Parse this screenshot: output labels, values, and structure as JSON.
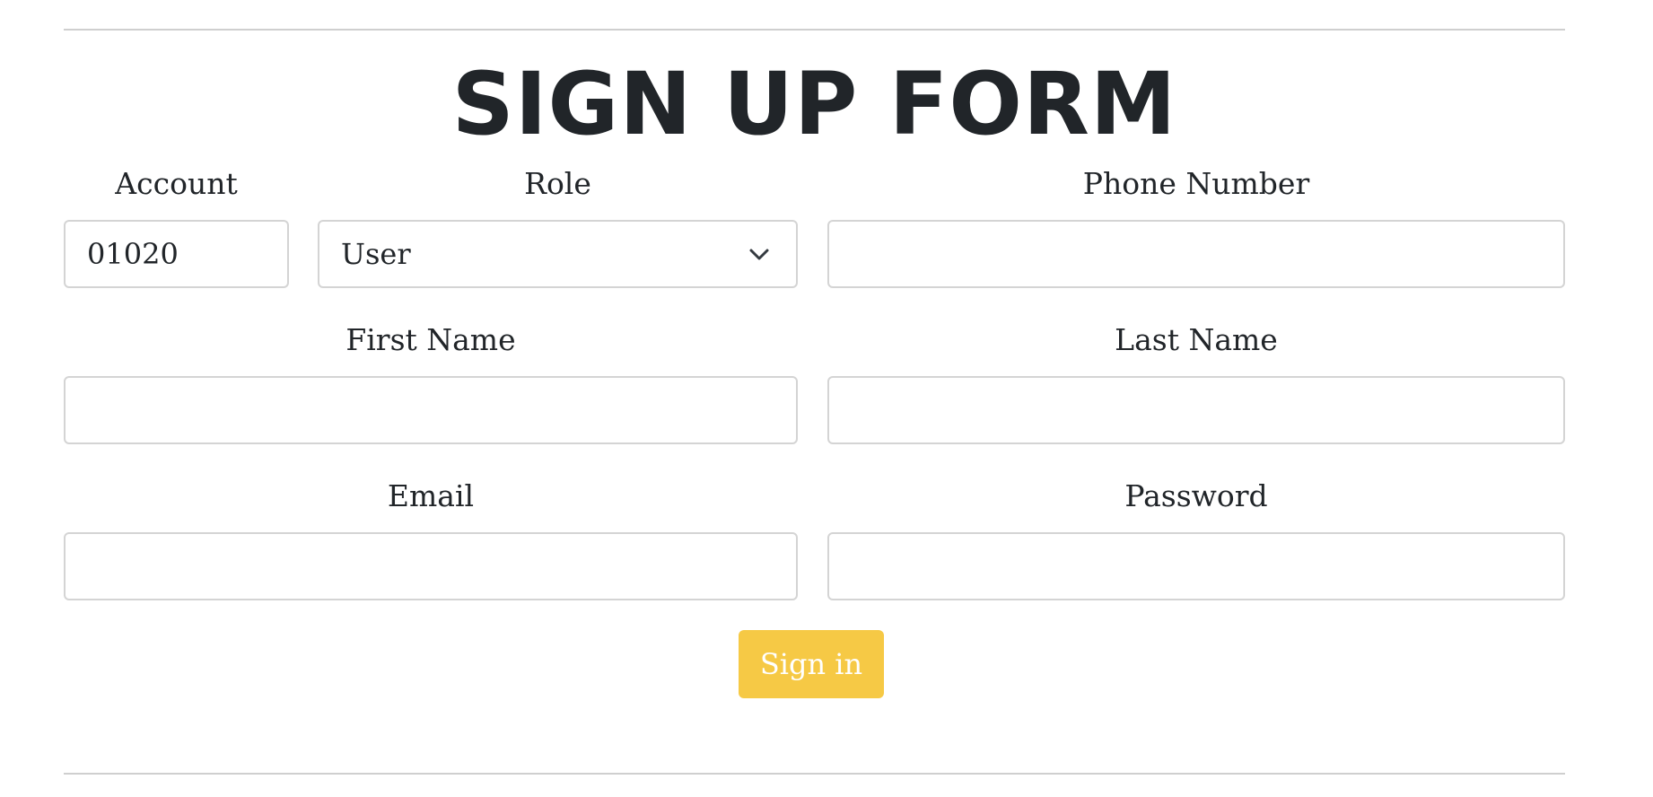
{
  "form": {
    "title": "SIGN UP FORM",
    "account": {
      "label": "Account",
      "value": "01020"
    },
    "role": {
      "label": "Role",
      "selected": "User"
    },
    "phone": {
      "label": "Phone Number",
      "value": ""
    },
    "first_name": {
      "label": "First Name",
      "value": ""
    },
    "last_name": {
      "label": "Last Name",
      "value": ""
    },
    "email": {
      "label": "Email",
      "value": ""
    },
    "password": {
      "label": "Password",
      "value": ""
    },
    "submit_label": "Sign in"
  },
  "colors": {
    "button": "#f6c945",
    "text": "#212529",
    "border": "#d4d4d4"
  }
}
